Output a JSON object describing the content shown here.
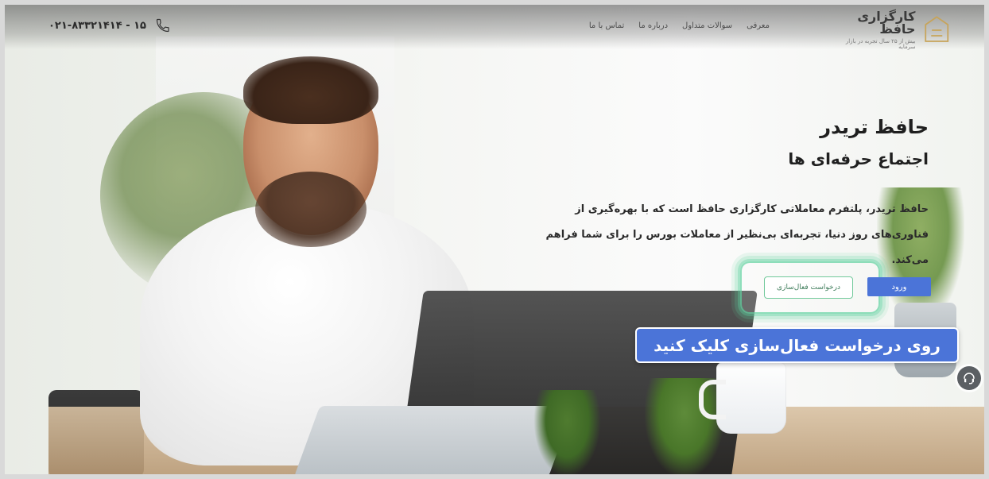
{
  "header": {
    "phone": "۰۲۱-۸۳۳۲۱۴۱۴ - ۱۵",
    "menu": [
      "معرفی",
      "سوالات متداول",
      "درباره ما",
      "تماس با ما"
    ],
    "logo_title": "کارگزاری حافظ",
    "logo_subtitle": "بیش از ۲۵ سال تجربه در بازار سرمایه"
  },
  "hero": {
    "title": "حافظ تریدر",
    "subtitle": "اجتماع حرفه‌ای ها",
    "description": "حافظ تریدر، پلتفرم معاملاتی کارگزاری حافظ است که با بهره‌گیری از فناوری‌های روز دنیا، تجربه‌ای بی‌نظیر از معاملات بورس را برای شما فراهم می‌کند."
  },
  "buttons": {
    "login": "ورود",
    "activation_request": "درخواست فعال‌سازی"
  },
  "tooltip": {
    "text": "روی درخواست فعال‌سازی کلیک کنید"
  },
  "colors": {
    "primary": "#4b74d8",
    "highlight": "#5fd2a0"
  },
  "icons": {
    "phone": "phone-icon",
    "support": "headset-icon"
  }
}
